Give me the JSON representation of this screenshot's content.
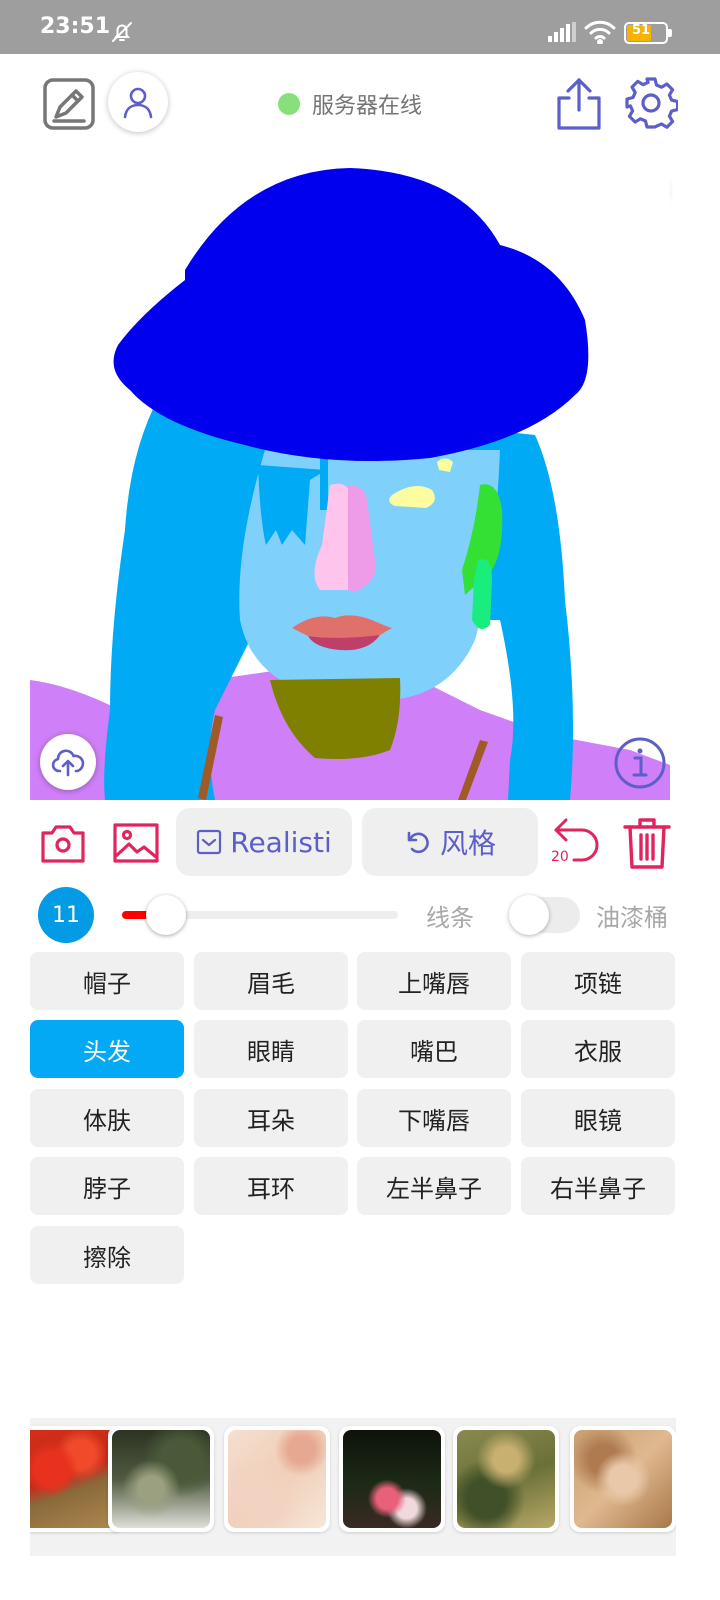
{
  "status_bar": {
    "time": "23:51",
    "battery_level": "51",
    "icons": [
      "bell-off-icon",
      "signal-icon",
      "wifi-icon",
      "battery-icon"
    ]
  },
  "header": {
    "server_status": "服务器在线",
    "server_status_color": "#88e07a",
    "icons": [
      "edit-icon",
      "user-icon",
      "share-icon",
      "gear-icon",
      "coffee-icon"
    ]
  },
  "canvas": {
    "icons": [
      "cloud-upload-icon",
      "info-icon"
    ],
    "colors": {
      "hat": "#0000ee",
      "hair": "#00aaf5",
      "skin": "#7fd1fb",
      "clothes": "#cf7ff7",
      "neck": "#7f7f00",
      "nose_left": "#ffc4ec",
      "nose_right": "#ee9be8",
      "lips_upper": "#e0706a",
      "lips_lower": "#bf3f6a",
      "eye": "#fefca0",
      "earring": "#19ed7d",
      "ear": "#33e033",
      "necklace": "#a05a28"
    }
  },
  "toolbar": {
    "model_label": "Realisti",
    "style_label": "风格",
    "undo_count": "20",
    "accent_color": "#e0245e",
    "pill_text_color": "#5b5fc7"
  },
  "brush": {
    "size": "11",
    "slider_value": 11,
    "slider_max": 100,
    "line_label": "线条",
    "bucket_label": "油漆桶",
    "bucket_enabled": false
  },
  "parts": [
    [
      "帽子",
      "眉毛",
      "上嘴唇",
      "项链"
    ],
    [
      "头发",
      "眼睛",
      "嘴巴",
      "衣服"
    ],
    [
      "体肤",
      "耳朵",
      "下嘴唇",
      "眼镜"
    ],
    [
      "脖子",
      "耳环",
      "左半鼻子",
      "右半鼻子"
    ],
    [
      "擦除"
    ]
  ],
  "selected_part": "头发",
  "style_thumbnails_count": 6
}
